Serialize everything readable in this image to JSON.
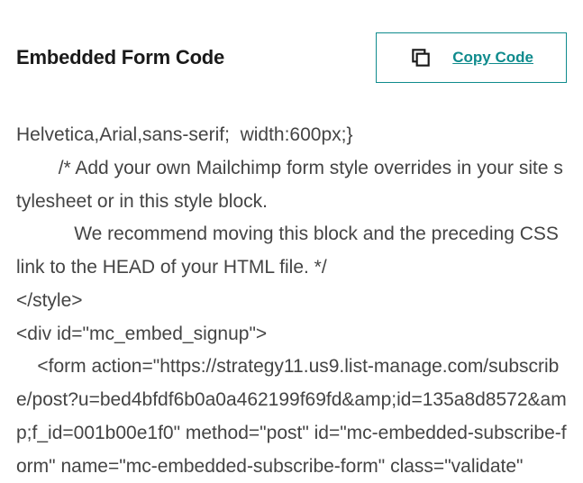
{
  "header": {
    "title": "Embedded Form Code",
    "copy_button_label": "Copy Code"
  },
  "icons": {
    "copy": "copy-icon"
  },
  "colors": {
    "accent": "#0f8b8d",
    "text": "#444",
    "title": "#1a1a1a"
  },
  "code": {
    "content": "Helvetica,Arial,sans-serif;  width:600px;}\n        /* Add your own Mailchimp form style overrides in your site stylesheet or in this style block.\n           We recommend moving this block and the preceding CSS link to the HEAD of your HTML file. */\n</style>\n<div id=\"mc_embed_signup\">\n    <form action=\"https://strategy11.us9.list-manage.com/subscribe/post?u=bed4bfdf6b0a0a462199f69fd&amp;id=135a8d8572&amp;f_id=001b00e1f0\" method=\"post\" id=\"mc-embedded-subscribe-form\" name=\"mc-embedded-subscribe-form\" class=\"validate\""
  }
}
